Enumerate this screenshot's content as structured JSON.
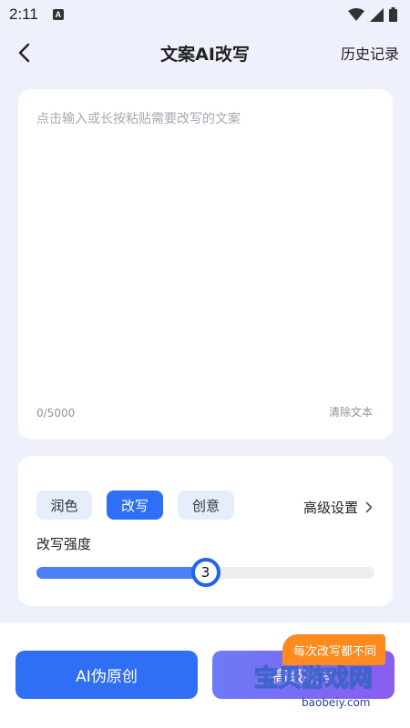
{
  "status_bar": {
    "time": "2:11",
    "notification_icon": "android-a-icon",
    "icons": [
      "wifi-icon",
      "signal-icon",
      "battery-icon"
    ]
  },
  "nav": {
    "title": "文案AI改写",
    "history_label": "历史记录",
    "back_icon": "chevron-left-icon"
  },
  "input": {
    "placeholder": "点击输入或长按粘贴需要改写的文案",
    "value": "",
    "char_count": "0/5000",
    "clear_label": "清除文本"
  },
  "options": {
    "modes": [
      {
        "label": "润色",
        "active": false
      },
      {
        "label": "改写",
        "active": true
      },
      {
        "label": "创意",
        "active": false
      }
    ],
    "advanced_label": "高级设置",
    "strength_label": "改写强度",
    "strength_value": "3",
    "strength_fraction": 0.5
  },
  "actions": {
    "ai_button_label": "AI伪原创",
    "senior_button_label": "高级改写",
    "promo_badge": "每次改写都不同"
  },
  "watermark": {
    "text": "宝贝游戏网",
    "url_text": "baobeiy.com"
  },
  "colors": {
    "accent": "#2f6ff5",
    "background": "#eef1fb",
    "promo": "#ff8a1e"
  }
}
